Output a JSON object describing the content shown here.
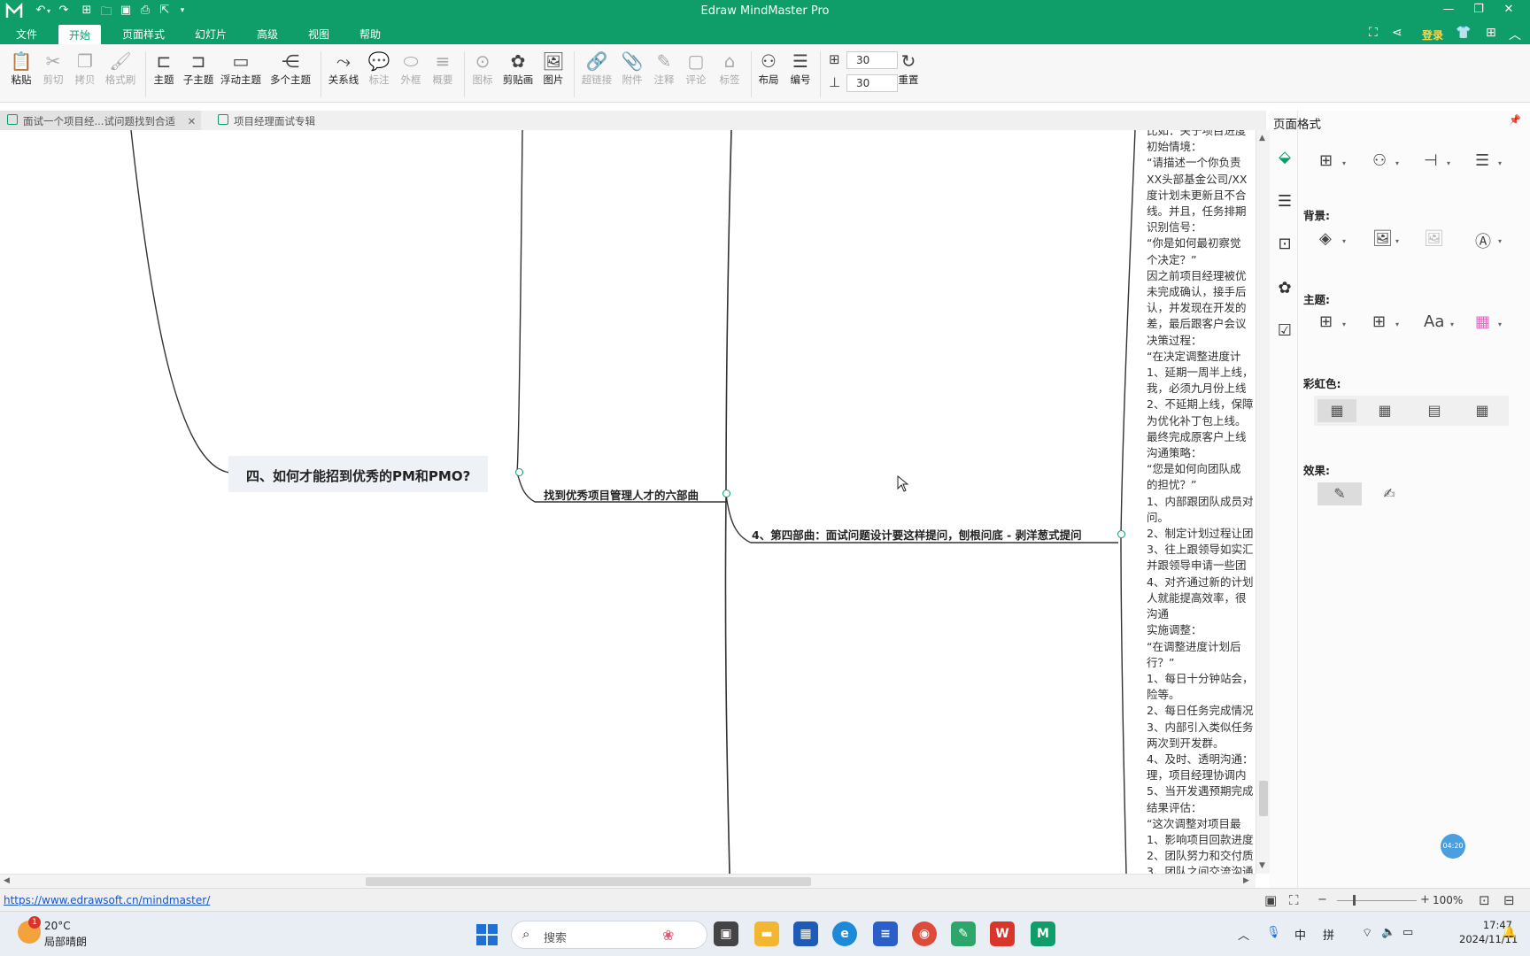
{
  "app": {
    "title": "Edraw MindMaster Pro"
  },
  "menu": {
    "items": [
      "文件",
      "开始",
      "页面样式",
      "幻灯片",
      "高级",
      "视图",
      "帮助"
    ],
    "active": "开始",
    "login": "登录"
  },
  "ribbon": {
    "paste": "粘贴",
    "cut": "剪切",
    "copy": "拷贝",
    "format_painter": "格式刷",
    "topic": "主题",
    "subtopic": "子主题",
    "floating_topic": "浮动主题",
    "multi_topic": "多个主题",
    "relation": "关系线",
    "callout": "标注",
    "boundary": "外框",
    "summary": "概要",
    "icon": "图标",
    "clipart": "剪贴画",
    "image": "图片",
    "hyperlink": "超链接",
    "attachment": "附件",
    "note": "注释",
    "comment": "评论",
    "tag": "标签",
    "layout": "布局",
    "numbering": "编号",
    "spacing_h": "30",
    "spacing_v": "30",
    "reset": "重置"
  },
  "tabs": [
    {
      "label": "面试一个项目经...试问题找到合适",
      "close": "✕"
    },
    {
      "label": "项目经理面试专辑"
    }
  ],
  "mindmap": {
    "main": "四、如何才能招到优秀的PM和PMO?",
    "sub1": "找到优秀项目管理人才的六部曲",
    "sub2": "4、第四部曲：面试问题设计要这样提问，刨根问底 - 剥洋葱式提问"
  },
  "note_lines": [
    "比如：关于项目进度",
    "初始情境：",
    "“请描述一个你负责",
    "XX头部基金公司/XX",
    "度计划未更新且不合",
    "线。并且，任务排期",
    "识别信号：",
    "“你是如何最初察觉",
    "个决定？”",
    "因之前项目经理被优",
    "未完成确认，接手后",
    "认，并发现在开发的",
    "差，最后跟客户会议",
    "决策过程：",
    "“在决定调整进度计",
    "1、延期一周半上线，",
    "我，必须九月份上线",
    "2、不延期上线，保障",
    "为优化补丁包上线。",
    "最终完成原客户上线",
    "沟通策略：",
    "“您是如何向团队成",
    "的担忧？”",
    "1、内部跟团队成员对",
    "问。",
    "2、制定计划过程让团",
    "3、往上跟领导如实汇",
    "并跟领导申请一些团",
    "4、对齐通过新的计划",
    "人就能提高效率，很",
    "沟通",
    "实施调整：",
    "“在调整进度计划后",
    "行？”",
    "1、每日十分钟站会，",
    "险等。",
    "2、每日任务完成情况",
    "3、内部引入类似任务",
    "两次到开发群。",
    "4、及时、透明沟通：",
    "理，项目经理协调内",
    "5、当开发遇预期完成",
    "结果评估：",
    "“这次调整对项目最",
    "1、影响项目回款进度",
    "2、团队努力和交付质",
    "3、团队之间交流沟通"
  ],
  "panel": {
    "title": "页面格式",
    "background": "背景:",
    "theme": "主题:",
    "rainbow": "彩虹色:",
    "effects": "效果:"
  },
  "status": {
    "link": "https://www.edrawsoft.cn/mindmaster/",
    "zoom": "100%",
    "timer": "04:20"
  },
  "taskbar": {
    "weather_temp": "20°C",
    "weather_desc": "局部晴朗",
    "weather_badge": "1",
    "search_placeholder": "搜索",
    "ime_lang": "中",
    "ime_mode": "拼",
    "time": "17:47",
    "date": "2024/11/11"
  },
  "colors": {
    "brand": "#0f9d69"
  }
}
